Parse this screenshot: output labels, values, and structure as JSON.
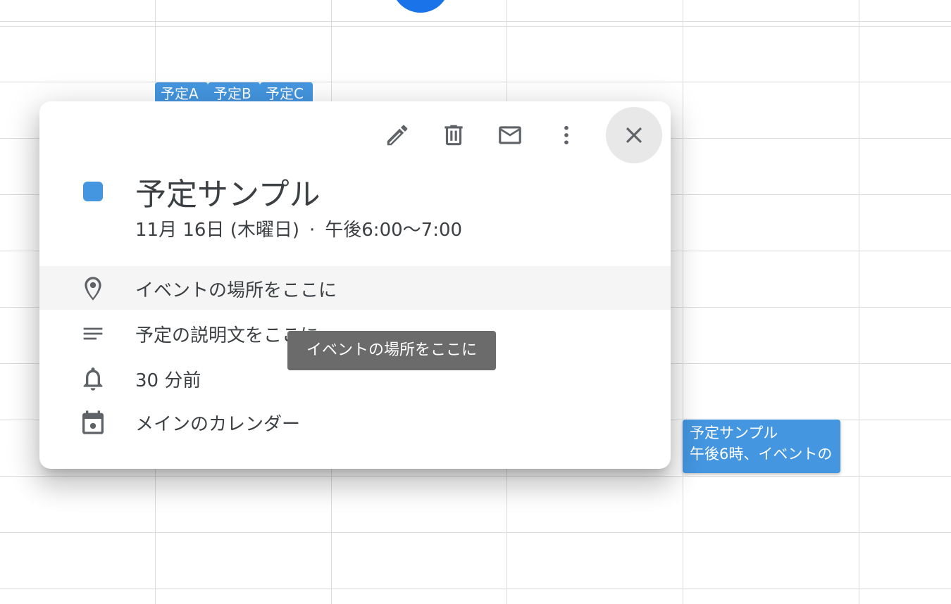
{
  "chips": [
    {
      "label": "予定A"
    },
    {
      "label": "予定B"
    },
    {
      "label": "予定C"
    }
  ],
  "event_block": {
    "title": "予定サンプル",
    "subtitle": "午後6時、イベントの"
  },
  "popup": {
    "event_title": "予定サンプル",
    "date": "11月 16日 (木曜日)",
    "separator": "·",
    "time": "午後6:00～7:00",
    "location": "イベントの場所をここに",
    "description": "予定の説明文をここに",
    "reminder": "30 分前",
    "calendar": "メインのカレンダー",
    "event_color": "#4496e0"
  },
  "tooltip": {
    "text": "イベントの場所をここに"
  },
  "icons": {
    "edit": "pencil-icon",
    "delete": "trash-icon",
    "email": "mail-icon",
    "more": "more-vert-icon",
    "close": "close-icon",
    "location": "map-pin-icon",
    "description": "notes-icon",
    "reminder": "bell-icon",
    "calendar": "calendar-icon"
  }
}
